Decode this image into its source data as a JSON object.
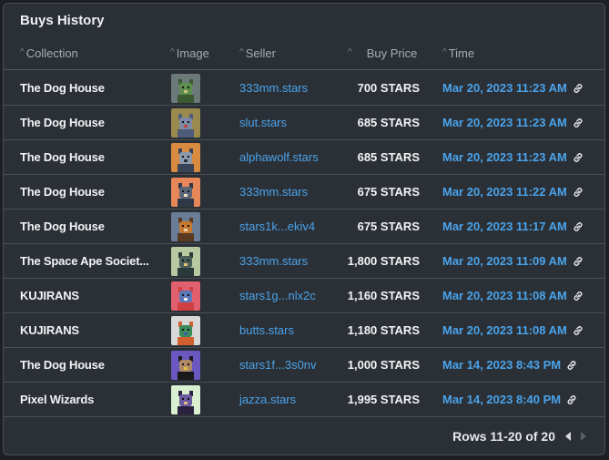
{
  "table": {
    "title": "Buys History",
    "columns": [
      "Collection",
      "Image",
      "Seller",
      "Buy Price",
      "Time"
    ],
    "rows": [
      {
        "collection": "The Dog House",
        "image": "dog-nft-green",
        "seller": "333mm.stars",
        "price": "700 STARS",
        "time": "Mar 20, 2023 11:23 AM"
      },
      {
        "collection": "The Dog House",
        "image": "dog-nft-gold",
        "seller": "slut.stars",
        "price": "685 STARS",
        "time": "Mar 20, 2023 11:23 AM"
      },
      {
        "collection": "The Dog House",
        "image": "dog-nft-orange-hat",
        "seller": "alphawolf.stars",
        "price": "685 STARS",
        "time": "Mar 20, 2023 11:23 AM"
      },
      {
        "collection": "The Dog House",
        "image": "dog-nft-orange",
        "seller": "333mm.stars",
        "price": "675 STARS",
        "time": "Mar 20, 2023 11:22 AM"
      },
      {
        "collection": "The Dog House",
        "image": "dog-nft-blue",
        "seller": "stars1k...ekiv4",
        "price": "675 STARS",
        "time": "Mar 20, 2023 11:17 AM"
      },
      {
        "collection": "The Space Ape Societ...",
        "image": "ape-nft",
        "seller": "333mm.stars",
        "price": "1,800 STARS",
        "time": "Mar 20, 2023 11:09 AM"
      },
      {
        "collection": "KUJIRANS",
        "image": "bird-nft-red",
        "seller": "stars1g...nlx2c",
        "price": "1,160 STARS",
        "time": "Mar 20, 2023 11:08 AM"
      },
      {
        "collection": "KUJIRANS",
        "image": "bird-nft-grey",
        "seller": "butts.stars",
        "price": "1,180 STARS",
        "time": "Mar 20, 2023 11:08 AM"
      },
      {
        "collection": "The Dog House",
        "image": "dog-nft-purple",
        "seller": "stars1f...3s0nv",
        "price": "1,000 STARS",
        "time": "Mar 14, 2023 8:43 PM"
      },
      {
        "collection": "Pixel Wizards",
        "image": "wizard-nft",
        "seller": "jazza.stars",
        "price": "1,995 STARS",
        "time": "Mar 14, 2023 8:40 PM"
      }
    ]
  },
  "pagination": {
    "label": "Rows 11-20 of 20"
  },
  "colors": {
    "link": "#4aa3ea",
    "panel": "#2b3036"
  }
}
